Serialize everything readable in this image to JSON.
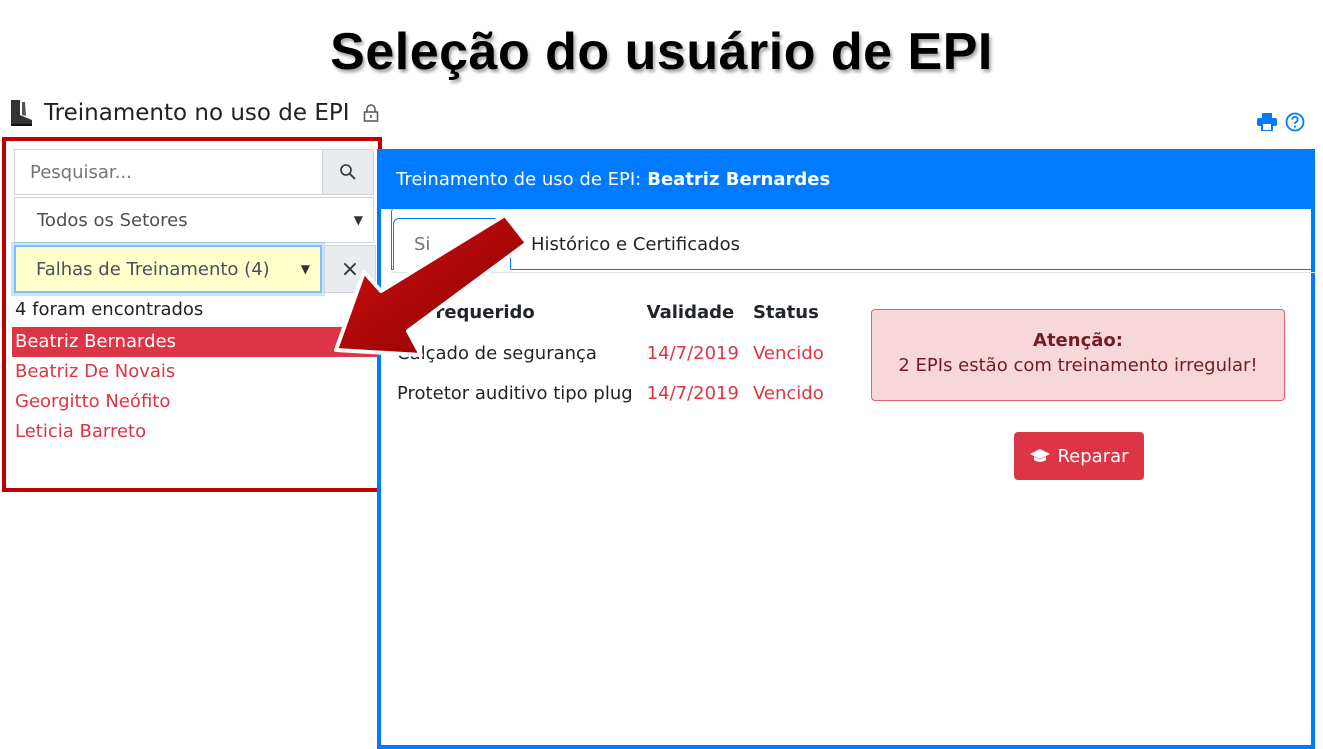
{
  "slide": {
    "title": "Seleção do usuário de EPI"
  },
  "page": {
    "title": "Treinamento no uso de EPI"
  },
  "sidebar": {
    "search_placeholder": "Pesquisar...",
    "sector_filter": "Todos os Setores",
    "status_filter": "Falhas de Treinamento (4)",
    "clear_label": "×",
    "found_count": "4 foram encontrados",
    "results": [
      "Beatriz Bernardes",
      "Beatriz De Novais",
      "Georgitto Neófito",
      "Leticia Barreto"
    ],
    "selected_index": 0
  },
  "main": {
    "header_prefix": "Treinamento de uso de EPI:",
    "header_name": "Beatriz Bernardes",
    "tabs": [
      {
        "label": "Si",
        "active": true
      },
      {
        "label": "Histórico e Certificados",
        "active": false
      }
    ],
    "table": {
      "headers": [
        "EPI requerido",
        "Validade",
        "Status"
      ],
      "rows": [
        [
          "Calçado de segurança",
          "14/7/2019",
          "Vencido"
        ],
        [
          "Protetor auditivo tipo plug",
          "14/7/2019",
          "Vencido"
        ]
      ]
    },
    "alert": {
      "title": "Atenção:",
      "message": "2 EPIs estão com treinamento irregular!"
    },
    "repair_button": "Reparar"
  },
  "colors": {
    "primary": "#007bff",
    "danger": "#dc3545",
    "highlight_border": "#c00000",
    "arrow": "#a00000"
  }
}
